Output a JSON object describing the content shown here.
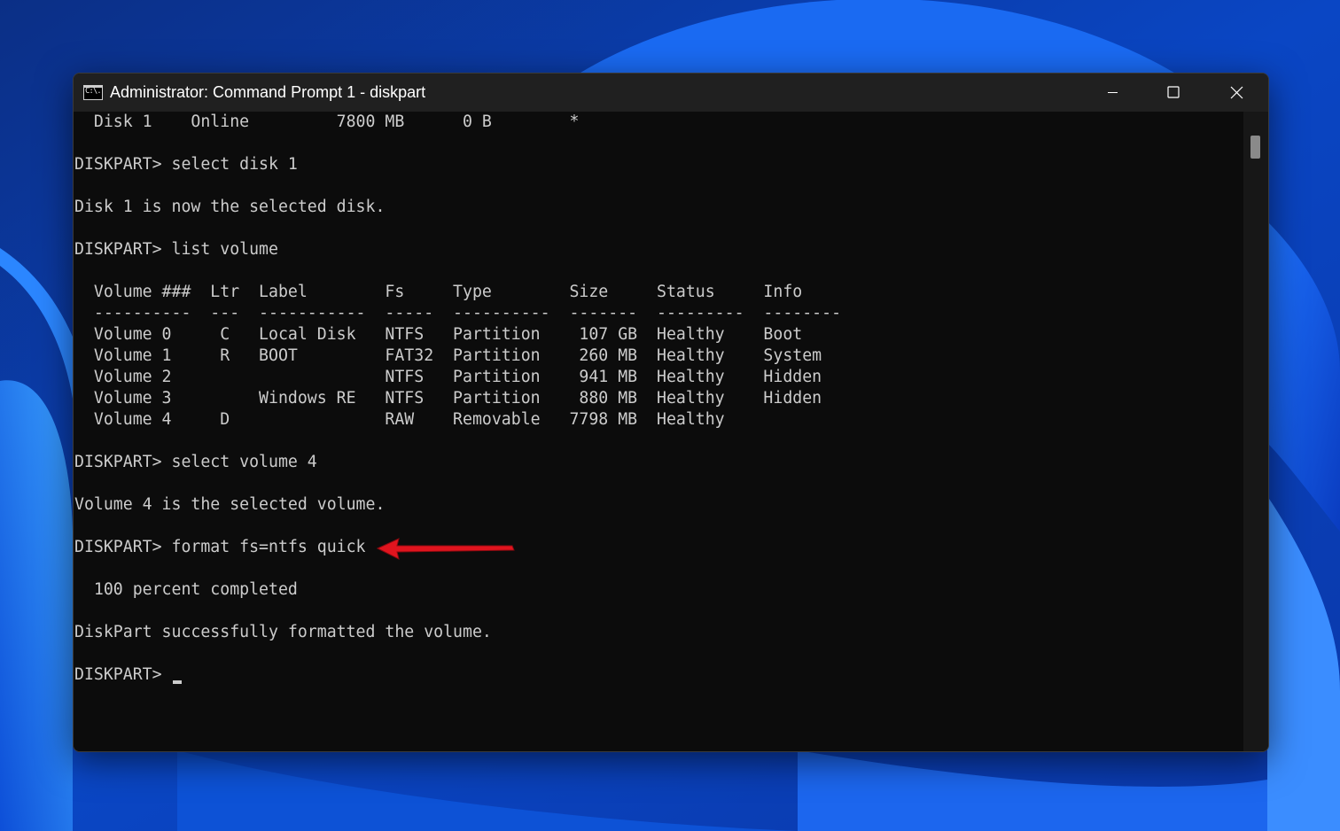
{
  "window": {
    "title": "Administrator: Command Prompt 1 - diskpart",
    "app_icon_text": "C:\\.",
    "controls": [
      "minimize-icon",
      "maximize-icon",
      "close-icon"
    ]
  },
  "console": {
    "lines": [
      "  Disk 1    Online         7800 MB      0 B        *",
      "",
      "DISKPART> select disk 1",
      "",
      "Disk 1 is now the selected disk.",
      "",
      "DISKPART> list volume",
      "",
      "  Volume ###  Ltr  Label        Fs     Type        Size     Status     Info",
      "  ----------  ---  -----------  -----  ----------  -------  ---------  --------",
      "  Volume 0     C   Local Disk   NTFS   Partition    107 GB  Healthy    Boot",
      "  Volume 1     R   BOOT         FAT32  Partition    260 MB  Healthy    System",
      "  Volume 2                      NTFS   Partition    941 MB  Healthy    Hidden",
      "  Volume 3         Windows RE   NTFS   Partition    880 MB  Healthy    Hidden",
      "  Volume 4     D                RAW    Removable   7798 MB  Healthy",
      "",
      "DISKPART> select volume 4",
      "",
      "Volume 4 is the selected volume.",
      "",
      "DISKPART> format fs=ntfs quick",
      "",
      "  100 percent completed",
      "",
      "DiskPart successfully formatted the volume.",
      "",
      "DISKPART> "
    ]
  },
  "colors": {
    "console_bg": "#0c0c0c",
    "console_text": "#cccccc",
    "titlebar_bg": "#202020",
    "annotation_arrow": "#e0141e"
  }
}
